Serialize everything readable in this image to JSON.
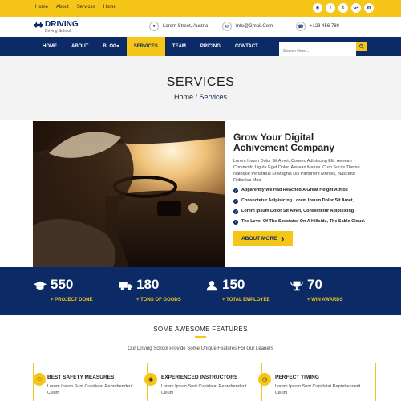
{
  "topbar": {
    "links": [
      "Home",
      "About",
      "Services",
      "Home"
    ],
    "socials": [
      "rss-icon",
      "facebook-icon",
      "twitter-icon",
      "google-plus-icon",
      "linkedin-icon"
    ],
    "social_glyphs": [
      "◉",
      "f",
      "t",
      "G+",
      "in"
    ]
  },
  "header": {
    "logo_title": "DRIVING",
    "logo_sub": "Driving School",
    "address": "Lorem Street, Austria",
    "email": "Info@Gmail.Com",
    "phone": "+123 456 789"
  },
  "nav": {
    "items": [
      "HOME",
      "ABOUT",
      "BLOG▾",
      "SERVICES",
      "TEAM",
      "PRICING",
      "CONTACT"
    ],
    "active_index": 3,
    "search_placeholder": "Search Here..."
  },
  "banner": {
    "title": "SERVICES",
    "crumb_home": "Home",
    "crumb_sep": " / ",
    "crumb_current": "Services"
  },
  "about": {
    "heading": "Grow Your Digital Achivement Company",
    "paragraph": "Lorem Ipsum Dolor Sit Amet, Consec Adipiscing Elit. Aenean Commodo Ligula Eget Dolor. Aenean Massa. Cum Sociis Theme Natoque Penatibus Et Magnis Dis Parturient Montes, Nascetur Ridiculus Mus.",
    "checks": [
      "Apparently We Had Reached A Great Height Atmos",
      "Consectetur Adipisicing Lorem Ipsum Dolor Sit Amet,",
      "Lorem Ipsum Dolor Sit Amet, Consectetur Adipisicing",
      "The Level Of The Spectator On A Hillside, The Sable Cloud."
    ],
    "button": "ABOUT MORE"
  },
  "stats": [
    {
      "num": "550",
      "label": "+ PROJECT DONE",
      "icon": "graduation-cap-icon"
    },
    {
      "num": "180",
      "label": "+ TONS OF GOODS",
      "icon": "truck-icon"
    },
    {
      "num": "150",
      "label": "+ TOTAL EMPLOYEE",
      "icon": "user-icon"
    },
    {
      "num": "70",
      "label": "+ WIN AWARDS",
      "icon": "trophy-icon"
    }
  ],
  "features": {
    "title": "SOME AWESOME FEATURES",
    "subtitle": "Our Driving School Provide Some Unique Features For Our Leaners",
    "cards": [
      {
        "title": "BEST SAFETY MEASURES",
        "text": "Lorem Ipsum Sunt Cupidatat Reprehenderit Cillum",
        "icon": "shield-icon"
      },
      {
        "title": "EXPERIENCED INSTRUCTORS",
        "text": "Lorem Ipsum Sunt Cupidatat Reprehenderit Cillum",
        "icon": "group-icon"
      },
      {
        "title": "PERFECT TIMING",
        "text": "Lorem Ipsum Sunt Cupidatat Reprehenderit Cillum",
        "icon": "clock-icon"
      }
    ]
  },
  "colors": {
    "brand_navy": "#0b2a66",
    "brand_yellow": "#f5c518"
  }
}
